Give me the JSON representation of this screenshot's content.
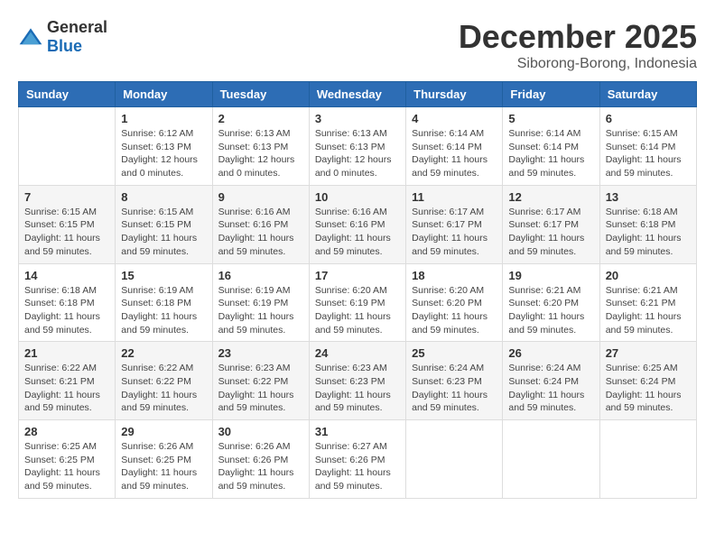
{
  "header": {
    "logo_general": "General",
    "logo_blue": "Blue",
    "month": "December 2025",
    "location": "Siborong-Borong, Indonesia"
  },
  "weekdays": [
    "Sunday",
    "Monday",
    "Tuesday",
    "Wednesday",
    "Thursday",
    "Friday",
    "Saturday"
  ],
  "weeks": [
    [
      {
        "day": "",
        "sunrise": "",
        "sunset": "",
        "daylight": ""
      },
      {
        "day": "1",
        "sunrise": "Sunrise: 6:12 AM",
        "sunset": "Sunset: 6:13 PM",
        "daylight": "Daylight: 12 hours and 0 minutes."
      },
      {
        "day": "2",
        "sunrise": "Sunrise: 6:13 AM",
        "sunset": "Sunset: 6:13 PM",
        "daylight": "Daylight: 12 hours and 0 minutes."
      },
      {
        "day": "3",
        "sunrise": "Sunrise: 6:13 AM",
        "sunset": "Sunset: 6:13 PM",
        "daylight": "Daylight: 12 hours and 0 minutes."
      },
      {
        "day": "4",
        "sunrise": "Sunrise: 6:14 AM",
        "sunset": "Sunset: 6:14 PM",
        "daylight": "Daylight: 11 hours and 59 minutes."
      },
      {
        "day": "5",
        "sunrise": "Sunrise: 6:14 AM",
        "sunset": "Sunset: 6:14 PM",
        "daylight": "Daylight: 11 hours and 59 minutes."
      },
      {
        "day": "6",
        "sunrise": "Sunrise: 6:15 AM",
        "sunset": "Sunset: 6:14 PM",
        "daylight": "Daylight: 11 hours and 59 minutes."
      }
    ],
    [
      {
        "day": "7",
        "sunrise": "Sunrise: 6:15 AM",
        "sunset": "Sunset: 6:15 PM",
        "daylight": "Daylight: 11 hours and 59 minutes."
      },
      {
        "day": "8",
        "sunrise": "Sunrise: 6:15 AM",
        "sunset": "Sunset: 6:15 PM",
        "daylight": "Daylight: 11 hours and 59 minutes."
      },
      {
        "day": "9",
        "sunrise": "Sunrise: 6:16 AM",
        "sunset": "Sunset: 6:16 PM",
        "daylight": "Daylight: 11 hours and 59 minutes."
      },
      {
        "day": "10",
        "sunrise": "Sunrise: 6:16 AM",
        "sunset": "Sunset: 6:16 PM",
        "daylight": "Daylight: 11 hours and 59 minutes."
      },
      {
        "day": "11",
        "sunrise": "Sunrise: 6:17 AM",
        "sunset": "Sunset: 6:17 PM",
        "daylight": "Daylight: 11 hours and 59 minutes."
      },
      {
        "day": "12",
        "sunrise": "Sunrise: 6:17 AM",
        "sunset": "Sunset: 6:17 PM",
        "daylight": "Daylight: 11 hours and 59 minutes."
      },
      {
        "day": "13",
        "sunrise": "Sunrise: 6:18 AM",
        "sunset": "Sunset: 6:18 PM",
        "daylight": "Daylight: 11 hours and 59 minutes."
      }
    ],
    [
      {
        "day": "14",
        "sunrise": "Sunrise: 6:18 AM",
        "sunset": "Sunset: 6:18 PM",
        "daylight": "Daylight: 11 hours and 59 minutes."
      },
      {
        "day": "15",
        "sunrise": "Sunrise: 6:19 AM",
        "sunset": "Sunset: 6:18 PM",
        "daylight": "Daylight: 11 hours and 59 minutes."
      },
      {
        "day": "16",
        "sunrise": "Sunrise: 6:19 AM",
        "sunset": "Sunset: 6:19 PM",
        "daylight": "Daylight: 11 hours and 59 minutes."
      },
      {
        "day": "17",
        "sunrise": "Sunrise: 6:20 AM",
        "sunset": "Sunset: 6:19 PM",
        "daylight": "Daylight: 11 hours and 59 minutes."
      },
      {
        "day": "18",
        "sunrise": "Sunrise: 6:20 AM",
        "sunset": "Sunset: 6:20 PM",
        "daylight": "Daylight: 11 hours and 59 minutes."
      },
      {
        "day": "19",
        "sunrise": "Sunrise: 6:21 AM",
        "sunset": "Sunset: 6:20 PM",
        "daylight": "Daylight: 11 hours and 59 minutes."
      },
      {
        "day": "20",
        "sunrise": "Sunrise: 6:21 AM",
        "sunset": "Sunset: 6:21 PM",
        "daylight": "Daylight: 11 hours and 59 minutes."
      }
    ],
    [
      {
        "day": "21",
        "sunrise": "Sunrise: 6:22 AM",
        "sunset": "Sunset: 6:21 PM",
        "daylight": "Daylight: 11 hours and 59 minutes."
      },
      {
        "day": "22",
        "sunrise": "Sunrise: 6:22 AM",
        "sunset": "Sunset: 6:22 PM",
        "daylight": "Daylight: 11 hours and 59 minutes."
      },
      {
        "day": "23",
        "sunrise": "Sunrise: 6:23 AM",
        "sunset": "Sunset: 6:22 PM",
        "daylight": "Daylight: 11 hours and 59 minutes."
      },
      {
        "day": "24",
        "sunrise": "Sunrise: 6:23 AM",
        "sunset": "Sunset: 6:23 PM",
        "daylight": "Daylight: 11 hours and 59 minutes."
      },
      {
        "day": "25",
        "sunrise": "Sunrise: 6:24 AM",
        "sunset": "Sunset: 6:23 PM",
        "daylight": "Daylight: 11 hours and 59 minutes."
      },
      {
        "day": "26",
        "sunrise": "Sunrise: 6:24 AM",
        "sunset": "Sunset: 6:24 PM",
        "daylight": "Daylight: 11 hours and 59 minutes."
      },
      {
        "day": "27",
        "sunrise": "Sunrise: 6:25 AM",
        "sunset": "Sunset: 6:24 PM",
        "daylight": "Daylight: 11 hours and 59 minutes."
      }
    ],
    [
      {
        "day": "28",
        "sunrise": "Sunrise: 6:25 AM",
        "sunset": "Sunset: 6:25 PM",
        "daylight": "Daylight: 11 hours and 59 minutes."
      },
      {
        "day": "29",
        "sunrise": "Sunrise: 6:26 AM",
        "sunset": "Sunset: 6:25 PM",
        "daylight": "Daylight: 11 hours and 59 minutes."
      },
      {
        "day": "30",
        "sunrise": "Sunrise: 6:26 AM",
        "sunset": "Sunset: 6:26 PM",
        "daylight": "Daylight: 11 hours and 59 minutes."
      },
      {
        "day": "31",
        "sunrise": "Sunrise: 6:27 AM",
        "sunset": "Sunset: 6:26 PM",
        "daylight": "Daylight: 11 hours and 59 minutes."
      },
      {
        "day": "",
        "sunrise": "",
        "sunset": "",
        "daylight": ""
      },
      {
        "day": "",
        "sunrise": "",
        "sunset": "",
        "daylight": ""
      },
      {
        "day": "",
        "sunrise": "",
        "sunset": "",
        "daylight": ""
      }
    ]
  ]
}
